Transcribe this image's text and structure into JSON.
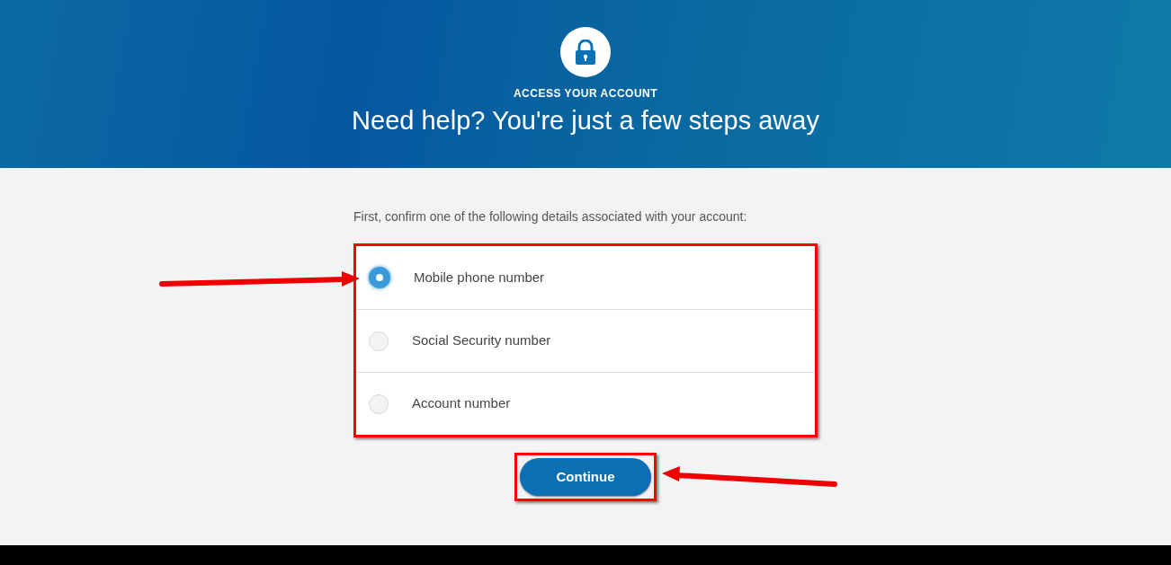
{
  "header": {
    "eyebrow": "ACCESS YOUR ACCOUNT",
    "title": "Need help? You're just a few steps away"
  },
  "prompt": "First, confirm one of the following details associated with your account:",
  "options": [
    {
      "label": "Mobile phone number",
      "selected": true
    },
    {
      "label": "Social Security number",
      "selected": false
    },
    {
      "label": "Account number",
      "selected": false
    }
  ],
  "button": {
    "label": "Continue"
  }
}
